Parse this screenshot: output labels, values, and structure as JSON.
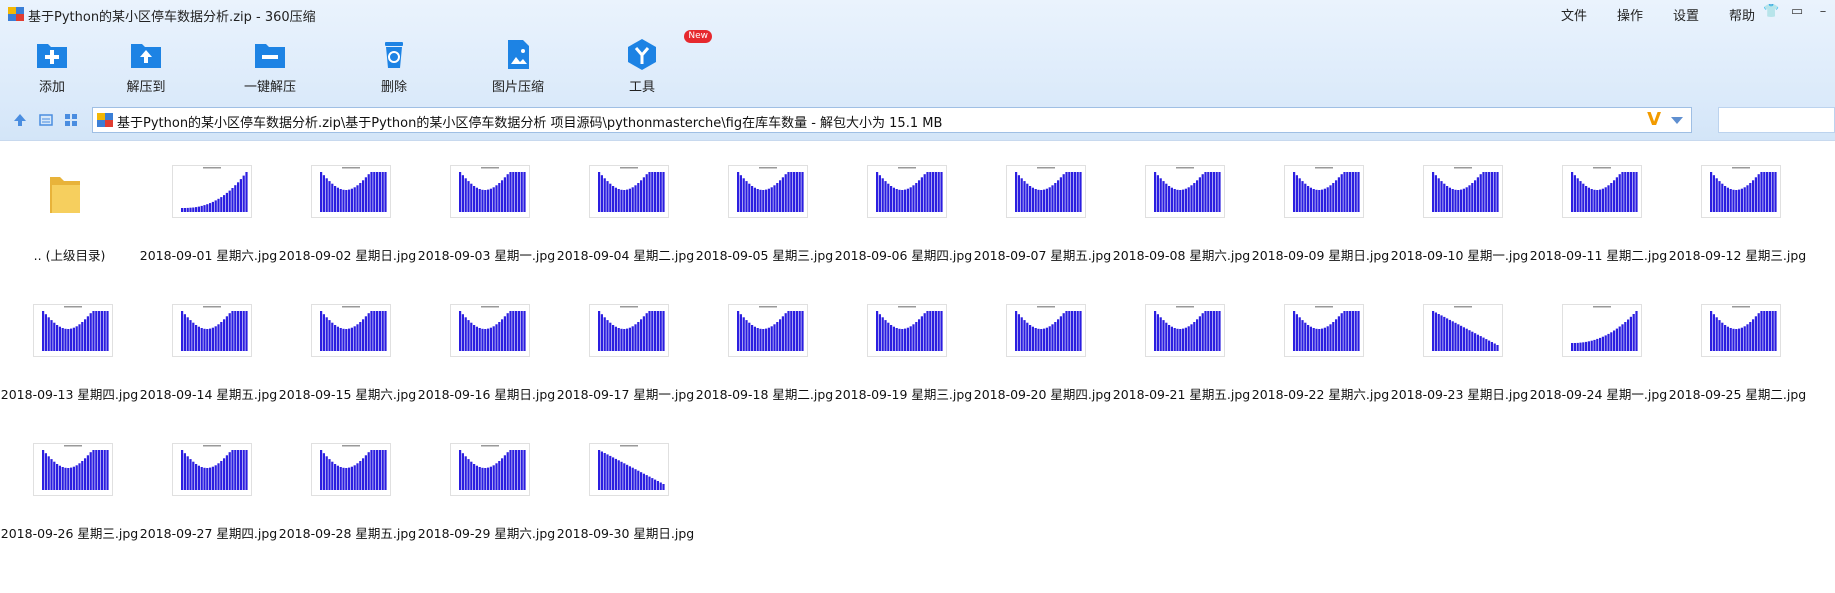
{
  "window": {
    "title": "基于Python的某小区停车数据分析.zip - 360压缩",
    "menus": [
      "文件",
      "操作",
      "设置",
      "帮助"
    ]
  },
  "toolbar": {
    "add": "添加",
    "extract_to": "解压到",
    "one_click_extract": "一键解压",
    "delete": "删除",
    "image_compress": "图片压缩",
    "tools": "工具",
    "new_badge": "New"
  },
  "address": {
    "path": "基于Python的某小区停车数据分析.zip\\基于Python的某小区停车数据分析 项目源码\\pythonmasterche\\fig在库车数量 - 解包大小为 15.1 MB"
  },
  "parent_folder": ".. (上级目录)",
  "files": [
    "2018-09-01 星期六.jpg",
    "2018-09-02 星期日.jpg",
    "2018-09-03 星期一.jpg",
    "2018-09-04 星期二.jpg",
    "2018-09-05 星期三.jpg",
    "2018-09-06 星期四.jpg",
    "2018-09-07 星期五.jpg",
    "2018-09-08 星期六.jpg",
    "2018-09-09 星期日.jpg",
    "2018-09-10 星期一.jpg",
    "2018-09-11 星期二.jpg",
    "2018-09-12 星期三.jpg",
    "2018-09-13 星期四.jpg",
    "2018-09-14 星期五.jpg",
    "2018-09-15 星期六.jpg",
    "2018-09-16 星期日.jpg",
    "2018-09-17 星期一.jpg",
    "2018-09-18 星期二.jpg",
    "2018-09-19 星期三.jpg",
    "2018-09-20 星期四.jpg",
    "2018-09-21 星期五.jpg",
    "2018-09-22 星期六.jpg",
    "2018-09-23 星期日.jpg",
    "2018-09-24 星期一.jpg",
    "2018-09-25 星期二.jpg",
    "2018-09-26 星期三.jpg",
    "2018-09-27 星期四.jpg",
    "2018-09-28 星期五.jpg",
    "2018-09-29 星期六.jpg",
    "2018-09-30 星期日.jpg"
  ],
  "colors": {
    "accent": "#1a7ad8",
    "bar": "#2b1ee0",
    "toolbar_bg": "#dbeafa"
  }
}
